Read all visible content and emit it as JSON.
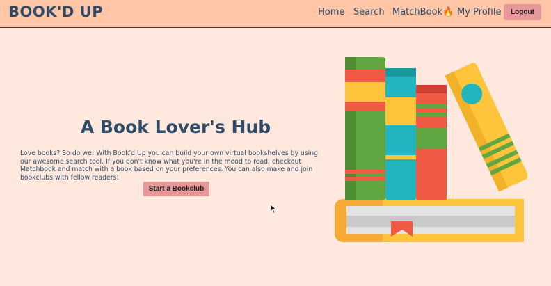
{
  "navbar": {
    "logo": "BOOK'D UP",
    "links": [
      "Home",
      "Search",
      "MatchBook🔥",
      "My Profile"
    ],
    "logout_label": "Logout"
  },
  "hero": {
    "title": "A Book Lover's Hub",
    "description": "Love books? So do we! With Book'd Up you can build your own virtual bookshelves by using our awesome search tool. If you don't know what you're in the mood to read, checkout Matchbook and match with a book based on your preferences. You can also make and join bookclubs with fellow readers!",
    "cta_label": "Start a Bookclub"
  },
  "illustration": {
    "icon": "book-stack-illustration"
  },
  "colors": {
    "background": "#ffe9de",
    "navbar": "#ffc6a8",
    "accent_button": "#e79898",
    "text_primary": "#2e4a66"
  }
}
